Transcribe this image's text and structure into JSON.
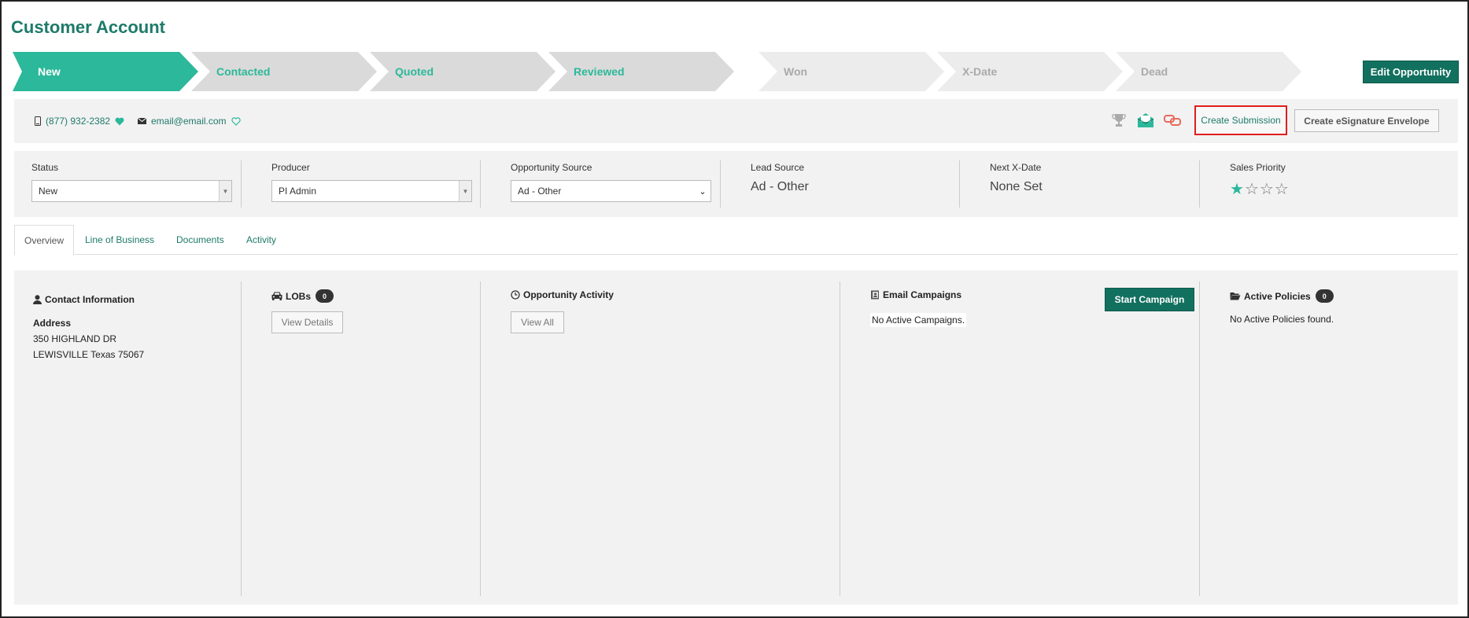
{
  "page": {
    "title": "Customer Account"
  },
  "pipeline": {
    "stages": [
      {
        "label": "New"
      },
      {
        "label": "Contacted"
      },
      {
        "label": "Quoted"
      },
      {
        "label": "Reviewed"
      },
      {
        "label": "Won"
      },
      {
        "label": "X-Date"
      },
      {
        "label": "Dead"
      }
    ],
    "edit_label": "Edit Opportunity"
  },
  "contact_bar": {
    "phone": "(877) 932-2382",
    "email": "email@email.com",
    "create_submission_label": "Create Submission",
    "esignature_label": "Create eSignature Envelope",
    "icons": [
      "trophy-icon",
      "envelope-open-icon",
      "link-icon"
    ]
  },
  "fields": {
    "status": {
      "label": "Status",
      "value": "New"
    },
    "producer": {
      "label": "Producer",
      "value": "PI Admin"
    },
    "opportunity_source": {
      "label": "Opportunity Source",
      "value": "Ad - Other"
    },
    "lead_source": {
      "label": "Lead Source",
      "value": "Ad - Other"
    },
    "next_xdate": {
      "label": "Next X-Date",
      "value": "None Set"
    },
    "sales_priority": {
      "label": "Sales Priority",
      "stars_filled": 1,
      "stars_total": 4
    }
  },
  "tabs": [
    {
      "label": "Overview"
    },
    {
      "label": "Line of Business"
    },
    {
      "label": "Documents"
    },
    {
      "label": "Activity"
    }
  ],
  "overview": {
    "contact": {
      "title": "Contact Information",
      "address_label": "Address",
      "address_line1": "350 HIGHLAND DR",
      "address_line2": "LEWISVILLE Texas 75067"
    },
    "lobs": {
      "title": "LOBs",
      "count": "0",
      "button": "View Details"
    },
    "activity": {
      "title": "Opportunity Activity",
      "button": "View All"
    },
    "campaigns": {
      "title": "Email Campaigns",
      "button": "Start Campaign",
      "empty": "No Active Campaigns."
    },
    "policies": {
      "title": "Active Policies",
      "count": "0",
      "empty": "No Active Policies found."
    }
  },
  "colors": {
    "accent": "#2cb89a",
    "brand_dark": "#12705f",
    "highlight": "#e01d1d"
  }
}
